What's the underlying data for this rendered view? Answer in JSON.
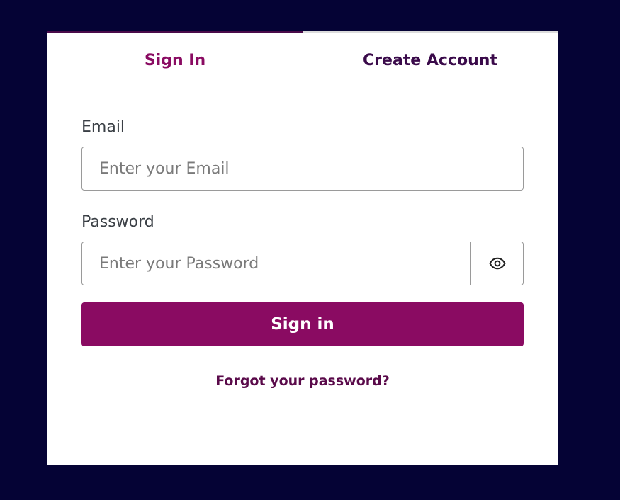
{
  "tabs": {
    "signin_label": "Sign In",
    "create_label": "Create Account"
  },
  "form": {
    "email_label": "Email",
    "email_placeholder": "Enter your Email",
    "email_value": "",
    "password_label": "Password",
    "password_placeholder": "Enter your Password",
    "password_value": "",
    "toggle_icon": "eye-icon",
    "submit_label": "Sign in",
    "forgot_label": "Forgot your password?"
  },
  "colors": {
    "page_background": "#050335",
    "card_background": "#ffffff",
    "accent": "#8a0b62",
    "tab_inactive_text": "#3a0a4a",
    "link": "#5a0a4a"
  }
}
